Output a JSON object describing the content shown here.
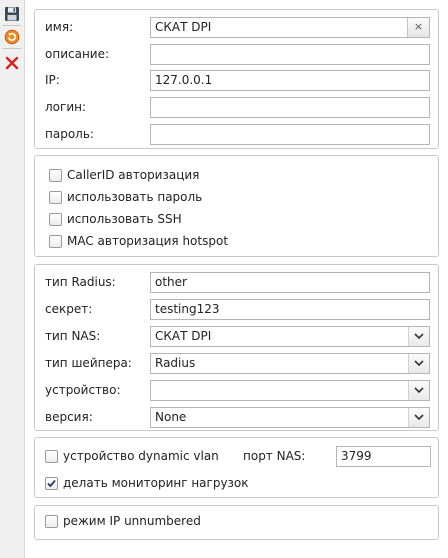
{
  "toolbar": {
    "save_icon": "floppy-disk-icon",
    "refresh_icon": "refresh-icon",
    "delete_icon": "red-x-icon"
  },
  "group1": {
    "name_label": "имя:",
    "name_value": "СКАТ DPI",
    "clear_symbol": "×",
    "description_label": "описание:",
    "description_value": "",
    "ip_label": "IP:",
    "ip_value": "127.0.0.1",
    "login_label": "логин:",
    "login_value": "",
    "password_label": "пароль:",
    "password_value": ""
  },
  "group2": {
    "callerid": {
      "label": "CallerID авторизация",
      "checked": false
    },
    "use_password": {
      "label": "использовать пароль",
      "checked": false
    },
    "use_ssh": {
      "label": "использовать SSH",
      "checked": false
    },
    "mac_auth": {
      "label": "MAC авторизация hotspot",
      "checked": false
    }
  },
  "group3": {
    "radius_type_label": "тип Radius:",
    "radius_type_value": "other",
    "secret_label": "секрет:",
    "secret_value": "testing123",
    "nas_type_label": "тип NAS:",
    "nas_type_value": "СКАТ DPI",
    "shaper_type_label": "тип шейпера:",
    "shaper_type_value": "Radius",
    "device_label": "устройство:",
    "device_value": "",
    "version_label": "версия:",
    "version_value": "None"
  },
  "group4": {
    "dynamic_vlan": {
      "label": "устройство dynamic vlan",
      "checked": false
    },
    "nas_port_label": "порт NAS:",
    "nas_port_value": "3799",
    "load_monitoring": {
      "label": "делать мониторинг нагрузок",
      "checked": true
    }
  },
  "group5": {
    "ip_unnumbered": {
      "label": "режим IP unnumbered",
      "checked": false
    }
  },
  "colors": {
    "border": "#c9c9c9",
    "field_border": "#b5b5b5",
    "delete_red": "#d9241c",
    "refresh_orange": "#e8761a"
  }
}
